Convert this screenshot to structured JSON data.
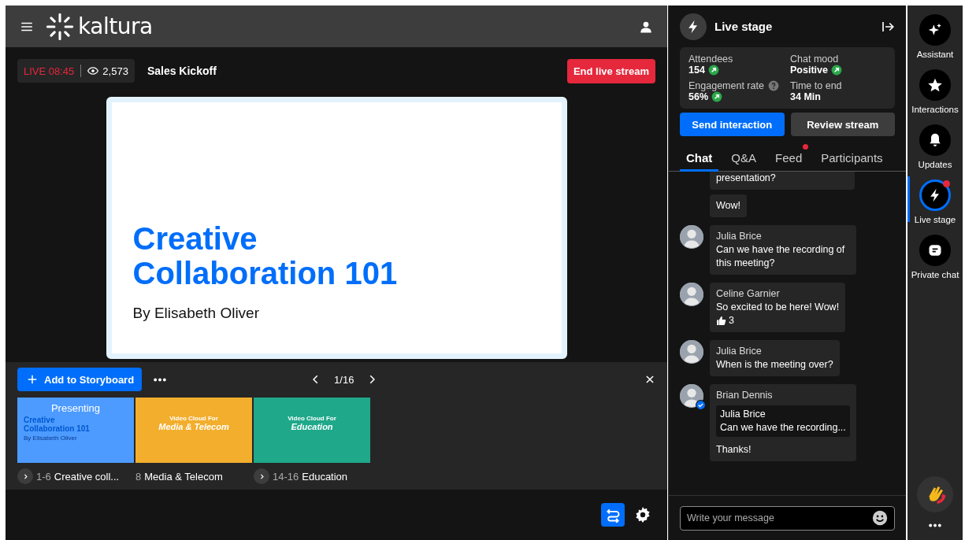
{
  "header": {
    "logo": "kaltura"
  },
  "live_bar": {
    "live": "LIVE 08:45",
    "viewers": "2,573",
    "title": "Sales Kickoff",
    "end_button": "End live stream"
  },
  "slide": {
    "title": "Creative Collaboration 101",
    "author": "By Elisabeth Oliver"
  },
  "storyboard": {
    "add_button": "Add to Storyboard",
    "page": "1/16",
    "thumbnails": [
      {
        "color": "#4d9bff",
        "kind": "title_slide",
        "heading": "Creative Collaboration 101",
        "subheading": "By Elisabeth Oliver",
        "overlay": "Presenting",
        "range": "1-6",
        "caption": "Creative coll...",
        "expandable": true
      },
      {
        "color": "#f2ae2c",
        "kind": "photo_slide",
        "heading": "Media & Telecom",
        "subheading": "Video Cloud For",
        "range": "8",
        "caption": "Media & Telecom",
        "expandable": false
      },
      {
        "color": "#1fa88a",
        "kind": "photo_slide",
        "heading": "Education",
        "subheading": "Video Cloud For",
        "range": "14-16",
        "caption": "Education",
        "expandable": true
      }
    ]
  },
  "live_stage": {
    "title": "Live stage",
    "stats": [
      {
        "label": "Attendees",
        "value": "154",
        "trend_up": true,
        "help": false
      },
      {
        "label": "Chat mood",
        "value": "Positive",
        "trend_up": true,
        "help": false
      },
      {
        "label": "Engagement rate",
        "value": "56%",
        "trend_up": true,
        "help": true
      },
      {
        "label": "Time to end",
        "value": "34 Min",
        "trend_up": false,
        "help": false
      }
    ],
    "buttons": [
      {
        "label": "Send interaction",
        "primary": true
      },
      {
        "label": "Review stream",
        "primary": false
      }
    ],
    "tabs": [
      {
        "label": "Chat",
        "selected": true,
        "badge": false
      },
      {
        "label": "Q&A",
        "selected": false,
        "badge": false
      },
      {
        "label": "Feed",
        "selected": false,
        "badge": true
      },
      {
        "label": "Participants",
        "selected": false,
        "badge": false
      }
    ],
    "messages": [
      {
        "kind": "continuation",
        "text": "presentation?"
      },
      {
        "kind": "continuation",
        "text": "Wow!"
      },
      {
        "kind": "message",
        "author": "Julia Brice",
        "text": "Can we have the recording of this meeting?",
        "verified": false
      },
      {
        "kind": "message",
        "author": "Celine Garnier",
        "text": "So excited to be here! Wow!",
        "reaction_count": "3",
        "verified": false
      },
      {
        "kind": "message",
        "author": "Julia Brice",
        "text": "When is the meeting over?",
        "verified": false
      },
      {
        "kind": "message",
        "author": "Brian Dennis",
        "reply": {
          "author": "Julia Brice",
          "text": "Can we have the recording..."
        },
        "text": "Thanks!",
        "verified": true
      }
    ],
    "input": {
      "placeholder": "Write your message"
    }
  },
  "rail": {
    "items": [
      {
        "label": "Assistant",
        "selected": false,
        "badge": false
      },
      {
        "label": "Interactions",
        "selected": false,
        "badge": false
      },
      {
        "label": "Updates",
        "selected": false,
        "badge": false
      },
      {
        "label": "Live stage",
        "selected": true,
        "badge": true
      },
      {
        "label": "Private chat",
        "selected": false,
        "badge": false
      }
    ]
  }
}
